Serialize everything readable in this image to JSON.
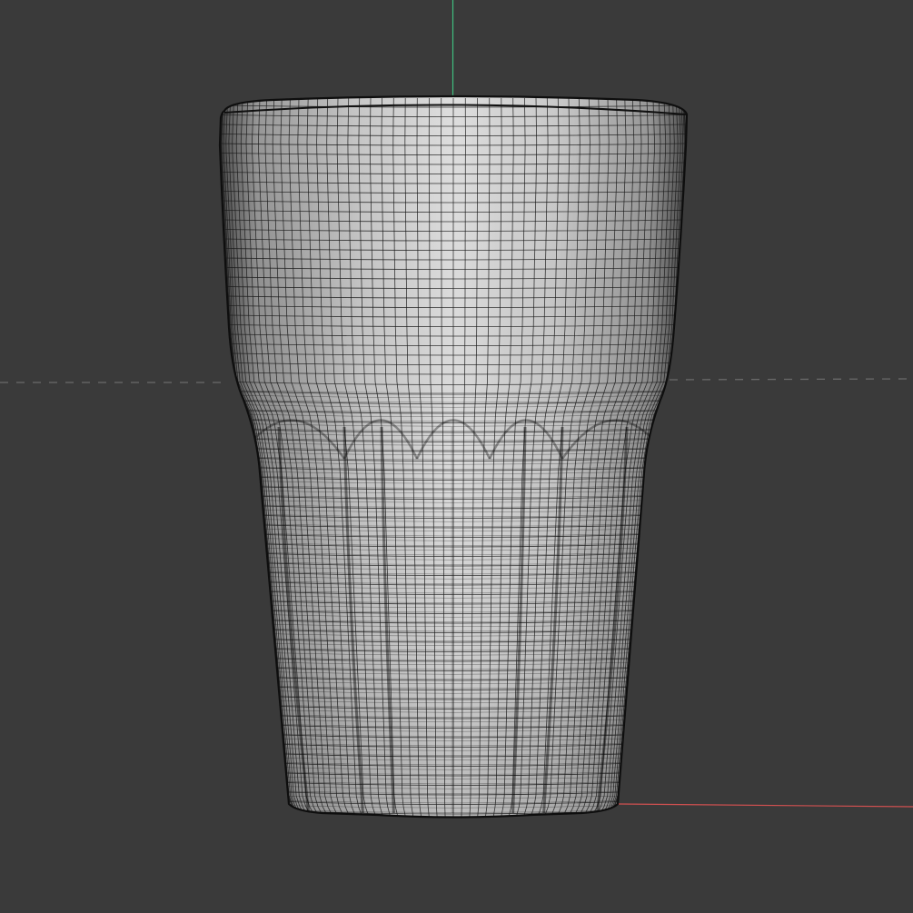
{
  "viewport": {
    "view": "front-orthographic",
    "display_mode": "wireframe-on-shaded",
    "background_color": "#3a3a3a",
    "object": {
      "name": "glass-tumbler-mesh",
      "shape": "faceted tumbler glass",
      "surface_color": "#c9c9c9",
      "wire_color": "#1b1b1b"
    },
    "axes": {
      "z_axis_color": "#3fbf7f",
      "x_axis_color": "#d05050",
      "ground_line_color": "#6a6a6a"
    }
  }
}
